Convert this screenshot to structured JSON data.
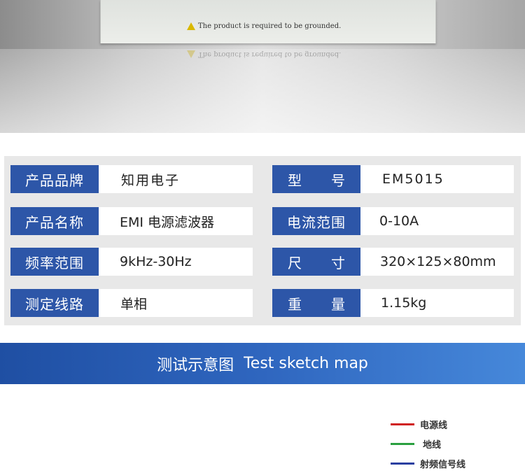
{
  "hero": {
    "warning_text": "The product is required to be grounded.",
    "warning_icon": "warning-triangle-icon"
  },
  "specs": {
    "rows": [
      {
        "left_label": "产品品牌",
        "left_value": "知用电子",
        "right_label_a": "型",
        "right_label_b": "号",
        "right_value": "EM5015"
      },
      {
        "left_label": "产品名称",
        "left_value": "EMI 电源滤波器",
        "right_label": "电流范围",
        "right_value": "0-10A"
      },
      {
        "left_label": "频率范围",
        "left_value": "9kHz-30Hz",
        "right_label_a": "尺",
        "right_label_b": "寸",
        "right_value": "320×125×80mm"
      },
      {
        "left_label": "测定线路",
        "left_value": "单相",
        "right_label_a": "重",
        "right_label_b": "量",
        "right_value": "1.15kg"
      }
    ]
  },
  "banner": {
    "title_cn": "测试示意图",
    "title_en": "Test sketch map"
  },
  "legend": {
    "items": [
      {
        "label": "电源线",
        "color": "#d02020"
      },
      {
        "label": "地线",
        "color": "#2aa040"
      },
      {
        "label": "射频信号线",
        "color": "#2a3fa0"
      }
    ]
  },
  "colors": {
    "label_bg": "#2d56a8",
    "panel_bg": "#e8e8e8",
    "banner_start": "#1f4fa3",
    "banner_end": "#4688da"
  }
}
